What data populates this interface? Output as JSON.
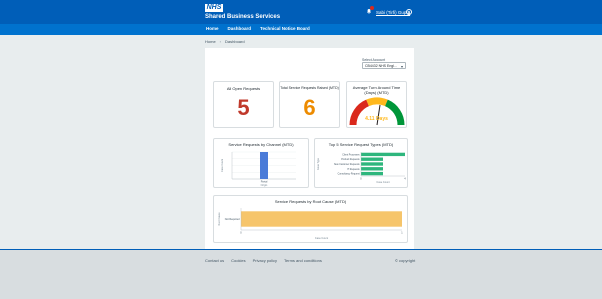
{
  "header": {
    "logo_text": "NHS",
    "brand_name": "Shared Business Services",
    "user_name": "Sabi (Tirfi) Gupta",
    "nav": [
      "Home",
      "Dashboard",
      "Technical Notice Board"
    ]
  },
  "breadcrumb": {
    "home": "Home",
    "current": "Dashboard"
  },
  "filter": {
    "label": "Select Account",
    "value": "CB4432 NHS Engl..."
  },
  "cards": {
    "open_requests": {
      "title": "All Open Requests",
      "value": "5",
      "color": "#c0392b"
    },
    "raised_mtd": {
      "title": "Total Service Requests Raised (MTD)",
      "value": "6",
      "color": "#ed8b00"
    },
    "turnaround": {
      "title": "Average Turn Around Time (Days) (MTD)",
      "value": "4.11 Days",
      "gauge": [
        "#da291c",
        "#ffb81c",
        "#009639"
      ],
      "needle_color": "#231f20"
    }
  },
  "chart_data": [
    {
      "type": "bar",
      "title": "Service Requests by Channel (MTD)",
      "ylabel": "Case Count",
      "categories": [
        "Portal"
      ],
      "xlabel": "Origin",
      "series": [
        {
          "values": [
            1
          ]
        }
      ],
      "color": "#4a7bd8",
      "grid": true
    },
    {
      "type": "bar",
      "orientation": "horizontal",
      "title": "Top 5 Service Request Types (MTD)",
      "ylabel": "Issue Type",
      "categories": [
        "Client Processes",
        "Product Requests",
        "New Customer Requests",
        "IT Requests",
        "Consultancy Request"
      ],
      "xlabel": "Case Count",
      "series": [
        {
          "values": [
            4,
            2,
            2,
            2,
            2
          ]
        }
      ],
      "color": "#2eb67d",
      "grid": true
    },
    {
      "type": "bar",
      "orientation": "horizontal",
      "title": "Service Requests by Root Cause (MTD)",
      "ylabel": "Root Cause",
      "categories": [
        "Not Required"
      ],
      "xlabel": "Case Count",
      "series": [
        {
          "values": [
            1
          ]
        }
      ],
      "color": "#f6c56b",
      "grid": true
    }
  ],
  "footer": {
    "links": [
      "Contact us",
      "Cookies",
      "Privacy policy",
      "Terms and conditions"
    ],
    "copyright": "© copyright"
  }
}
